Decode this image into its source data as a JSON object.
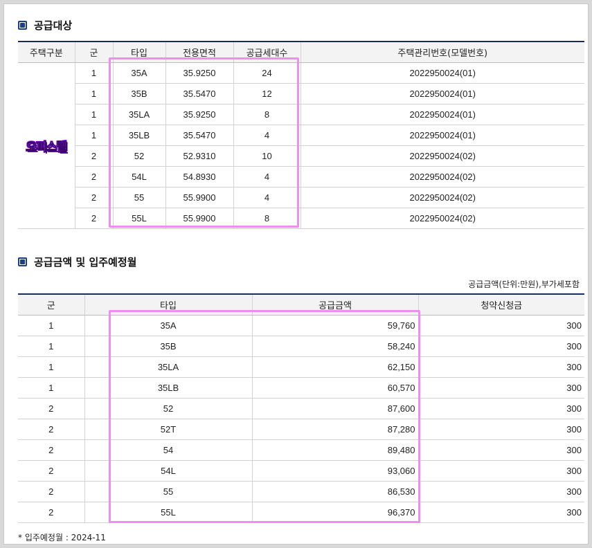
{
  "section1": {
    "title": "공급대상",
    "headers": [
      "주택구분",
      "군",
      "타입",
      "전용면적",
      "공급세대수",
      "주택관리번호(모델번호)"
    ],
    "category": "오피스텔",
    "rows": [
      {
        "group": "1",
        "type": "35A",
        "area": "35.9250",
        "units": "24",
        "mgmt": "2022950024(01)"
      },
      {
        "group": "1",
        "type": "35B",
        "area": "35.5470",
        "units": "12",
        "mgmt": "2022950024(01)"
      },
      {
        "group": "1",
        "type": "35LA",
        "area": "35.9250",
        "units": "8",
        "mgmt": "2022950024(01)"
      },
      {
        "group": "1",
        "type": "35LB",
        "area": "35.5470",
        "units": "4",
        "mgmt": "2022950024(01)"
      },
      {
        "group": "2",
        "type": "52",
        "area": "52.9310",
        "units": "10",
        "mgmt": "2022950024(02)"
      },
      {
        "group": "2",
        "type": "54L",
        "area": "54.8930",
        "units": "4",
        "mgmt": "2022950024(02)"
      },
      {
        "group": "2",
        "type": "55",
        "area": "55.9900",
        "units": "4",
        "mgmt": "2022950024(02)"
      },
      {
        "group": "2",
        "type": "55L",
        "area": "55.9900",
        "units": "8",
        "mgmt": "2022950024(02)"
      }
    ]
  },
  "section2": {
    "title": "공급금액 및 입주예정월",
    "unit_note": "공급금액(단위:만원),부가세포함",
    "headers": [
      "군",
      "타입",
      "공급금액",
      "청약신청금"
    ],
    "rows": [
      {
        "group": "1",
        "type": "35A",
        "price": "59,760",
        "deposit": "300"
      },
      {
        "group": "1",
        "type": "35B",
        "price": "58,240",
        "deposit": "300"
      },
      {
        "group": "1",
        "type": "35LA",
        "price": "62,150",
        "deposit": "300"
      },
      {
        "group": "1",
        "type": "35LB",
        "price": "60,570",
        "deposit": "300"
      },
      {
        "group": "2",
        "type": "52",
        "price": "87,600",
        "deposit": "300"
      },
      {
        "group": "2",
        "type": "52T",
        "price": "87,280",
        "deposit": "300"
      },
      {
        "group": "2",
        "type": "54",
        "price": "89,480",
        "deposit": "300"
      },
      {
        "group": "2",
        "type": "54L",
        "price": "93,060",
        "deposit": "300"
      },
      {
        "group": "2",
        "type": "55",
        "price": "86,530",
        "deposit": "300"
      },
      {
        "group": "2",
        "type": "55L",
        "price": "96,370",
        "deposit": "300"
      }
    ],
    "footnote": "* 입주예정월 : 2024-11"
  },
  "colors": {
    "header_rule": "#1a2a5e",
    "icon": "#1a3d8f",
    "highlight": "#ee8ef0",
    "category_text": "#7b00d6"
  }
}
